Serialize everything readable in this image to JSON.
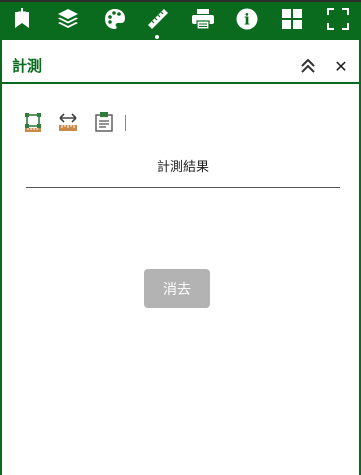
{
  "toolbar": {
    "items": [
      {
        "icon": "bookmark-add-icon"
      },
      {
        "icon": "layers-icon"
      },
      {
        "icon": "basemap-palette-icon"
      },
      {
        "icon": "ruler-icon",
        "active": true
      },
      {
        "icon": "printer-icon"
      },
      {
        "icon": "info-icon"
      },
      {
        "icon": "grid-icon"
      },
      {
        "icon": "fullscreen-icon"
      }
    ],
    "info_glyph": "i"
  },
  "panel": {
    "title": "計測",
    "collapse_icon": "double-chevron-up-icon",
    "close_icon": "close-icon",
    "close_glyph": "✕"
  },
  "measure": {
    "tools": [
      {
        "icon": "area-measure-icon"
      },
      {
        "icon": "distance-measure-icon"
      },
      {
        "icon": "location-measure-icon"
      }
    ],
    "result_label": "計測結果",
    "clear_label": "消去"
  },
  "colors": {
    "brand_green": "#0a6b1f",
    "disabled_button": "#b3b3b3"
  }
}
